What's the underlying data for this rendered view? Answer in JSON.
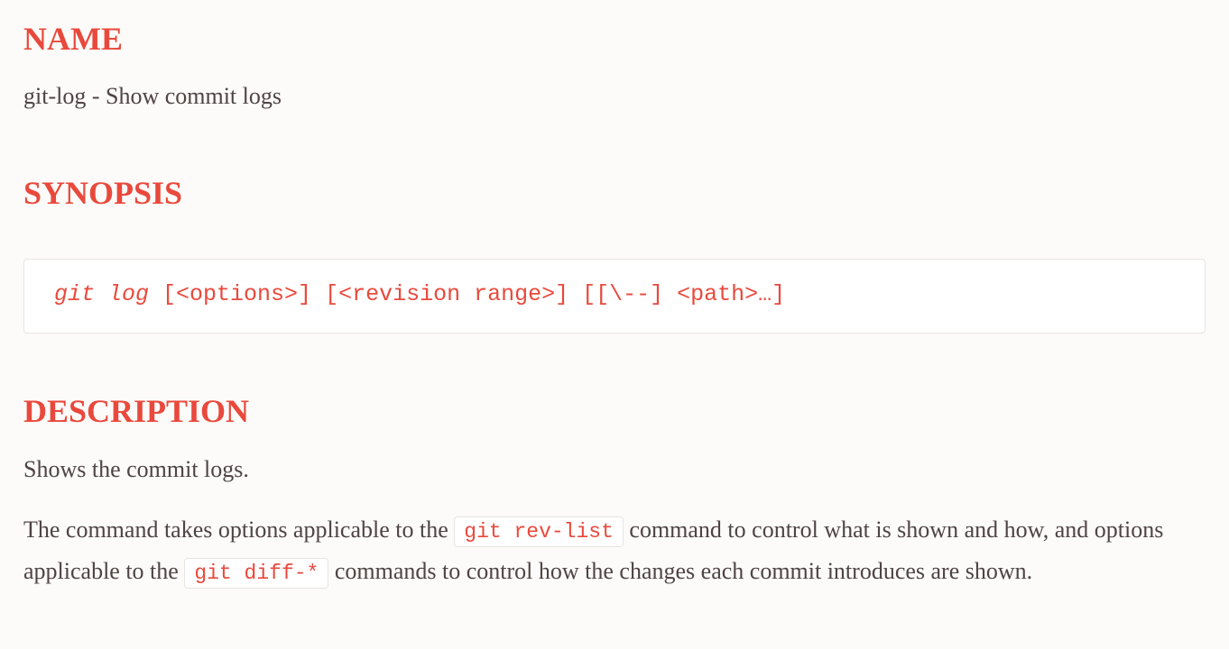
{
  "sections": {
    "name": {
      "heading": "NAME",
      "text": "git-log - Show commit logs"
    },
    "synopsis": {
      "heading": "SYNOPSIS",
      "command_italic": "git log",
      "command_rest": " [<options>] [<revision range>] [[\\--] <path>…]"
    },
    "description": {
      "heading": "DESCRIPTION",
      "para1": "Shows the commit logs.",
      "para2_part1": "The command takes options applicable to the ",
      "para2_code1": "git rev-list",
      "para2_part2": " command to control what is shown and how, and options applicable to the ",
      "para2_code2": "git diff-*",
      "para2_part3": " commands to control how the changes each commit introduces are shown."
    }
  },
  "colors": {
    "heading": "#e9493c",
    "text": "#4e4443",
    "background": "#fcfbf9",
    "code": "#e9493c"
  }
}
